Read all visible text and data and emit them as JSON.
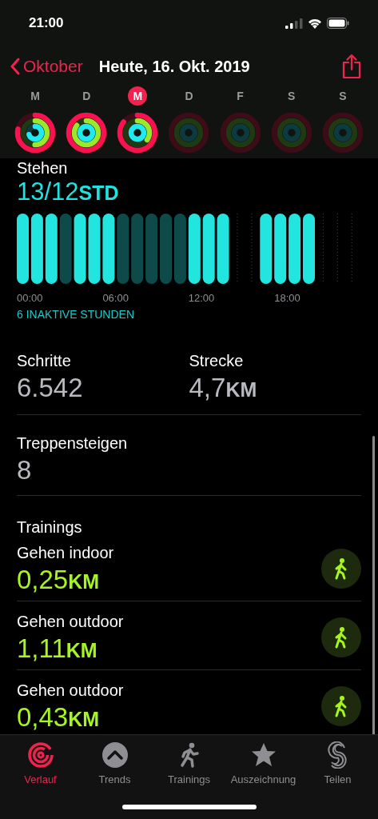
{
  "status_bar": {
    "time": "21:00"
  },
  "nav": {
    "back": "Oktober",
    "title": "Heute, 16. Okt. 2019"
  },
  "week": [
    {
      "label": "M",
      "selected": false
    },
    {
      "label": "D",
      "selected": false
    },
    {
      "label": "M",
      "selected": true
    },
    {
      "label": "D",
      "selected": false
    },
    {
      "label": "F",
      "selected": false
    },
    {
      "label": "S",
      "selected": false
    },
    {
      "label": "S",
      "selected": false
    }
  ],
  "stand": {
    "title": "Stehen",
    "value": "13/12",
    "unit": "STD",
    "footer": "6 INAKTIVE STUNDEN",
    "hours": [
      {
        "kind": "active"
      },
      {
        "kind": "active"
      },
      {
        "kind": "active"
      },
      {
        "kind": "inactive"
      },
      {
        "kind": "active"
      },
      {
        "kind": "active"
      },
      {
        "kind": "active"
      },
      {
        "kind": "inactive"
      },
      {
        "kind": "inactive"
      },
      {
        "kind": "inactive"
      },
      {
        "kind": "inactive"
      },
      {
        "kind": "inactive"
      },
      {
        "kind": "active"
      },
      {
        "kind": "active"
      },
      {
        "kind": "active"
      },
      {
        "kind": "none"
      },
      {
        "kind": "none"
      },
      {
        "kind": "active"
      },
      {
        "kind": "active"
      },
      {
        "kind": "active"
      },
      {
        "kind": "active"
      },
      {
        "kind": "none"
      },
      {
        "kind": "none"
      },
      {
        "kind": "none"
      }
    ],
    "hour_labels": [
      "00:00",
      "06:00",
      "12:00",
      "18:00"
    ]
  },
  "stats": [
    {
      "label": "Schritte",
      "value": "6.542"
    },
    {
      "label": "Strecke",
      "value": "4,7",
      "unit": "KM"
    }
  ],
  "stairs": {
    "label": "Treppensteigen",
    "value": "8"
  },
  "trainings": {
    "title": "Trainings",
    "items": [
      {
        "name": "Gehen indoor",
        "value": "0,25",
        "unit": "KM"
      },
      {
        "name": "Gehen outdoor",
        "value": "1,11",
        "unit": "KM"
      },
      {
        "name": "Gehen outdoor",
        "value": "0,43",
        "unit": "KM"
      }
    ]
  },
  "tabs": [
    {
      "label": "Verlauf",
      "kind": "history",
      "selected": true
    },
    {
      "label": "Trends",
      "kind": "trends",
      "selected": false
    },
    {
      "label": "Trainings",
      "kind": "workouts",
      "selected": false
    },
    {
      "label": "Auszeichnung",
      "kind": "awards",
      "selected": false
    },
    {
      "label": "Teilen",
      "kind": "sharing",
      "selected": false
    }
  ]
}
